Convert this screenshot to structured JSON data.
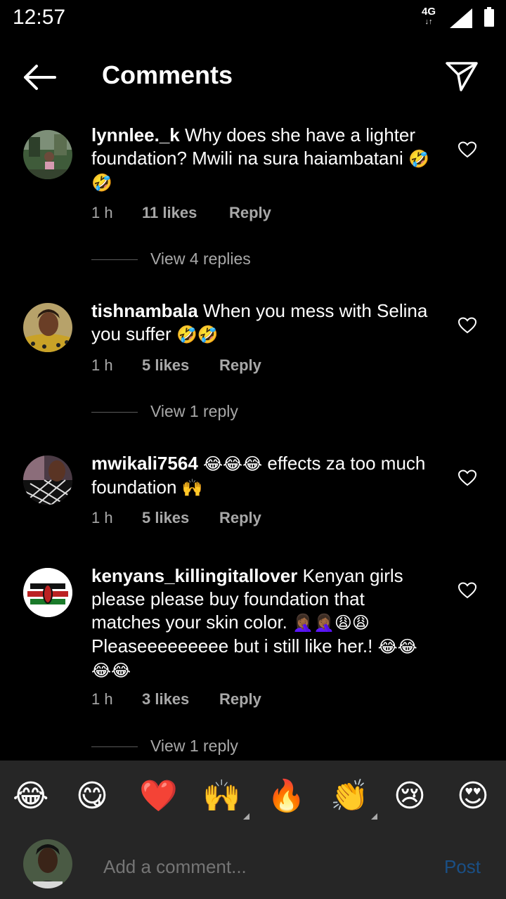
{
  "status": {
    "time": "12:57",
    "network": "4G"
  },
  "header": {
    "title": "Comments"
  },
  "comments": [
    {
      "username": "lynnlee._k",
      "text": "Why does she have a lighter foundation? Mwili na sura haiambatani",
      "emoji": "🤣🤣",
      "time": "1 h",
      "likes": "11 likes",
      "reply": "Reply",
      "view_replies": "View 4 replies"
    },
    {
      "username": "tishnambala",
      "text": "When you mess with Selina you suffer",
      "emoji": "🤣🤣",
      "time": "1 h",
      "likes": "5 likes",
      "reply": "Reply",
      "view_replies": "View 1 reply"
    },
    {
      "username": "mwikali7564",
      "emoji_inline": "😂😂😂",
      "text": "effects za too much foundation",
      "emoji": "🙌",
      "time": "1 h",
      "likes": "5 likes",
      "reply": "Reply"
    },
    {
      "username": "kenyans_killingitallover",
      "text": "Kenyan girls please please buy foundation that matches your skin color.",
      "emoji_inline": "🤦🏾‍♀️🤦🏾‍♀️😩😩",
      "text2": "Pleaseeeeeeeee but  i still like her.!",
      "emoji": "😂😂😂😂",
      "time": "1 h",
      "likes": "3 likes",
      "reply": "Reply",
      "view_replies": "View 1 reply"
    }
  ],
  "emoji_bar": [
    "😂",
    "😋",
    "❤️",
    "🙌",
    "🔥",
    "👏",
    "😢",
    "😍"
  ],
  "comment_box": {
    "placeholder": "Add a comment...",
    "post_label": "Post"
  },
  "colors": {
    "background": "#000000",
    "panel": "#262626",
    "muted": "#a8a8a8",
    "post_disabled": "#1a4f85"
  }
}
